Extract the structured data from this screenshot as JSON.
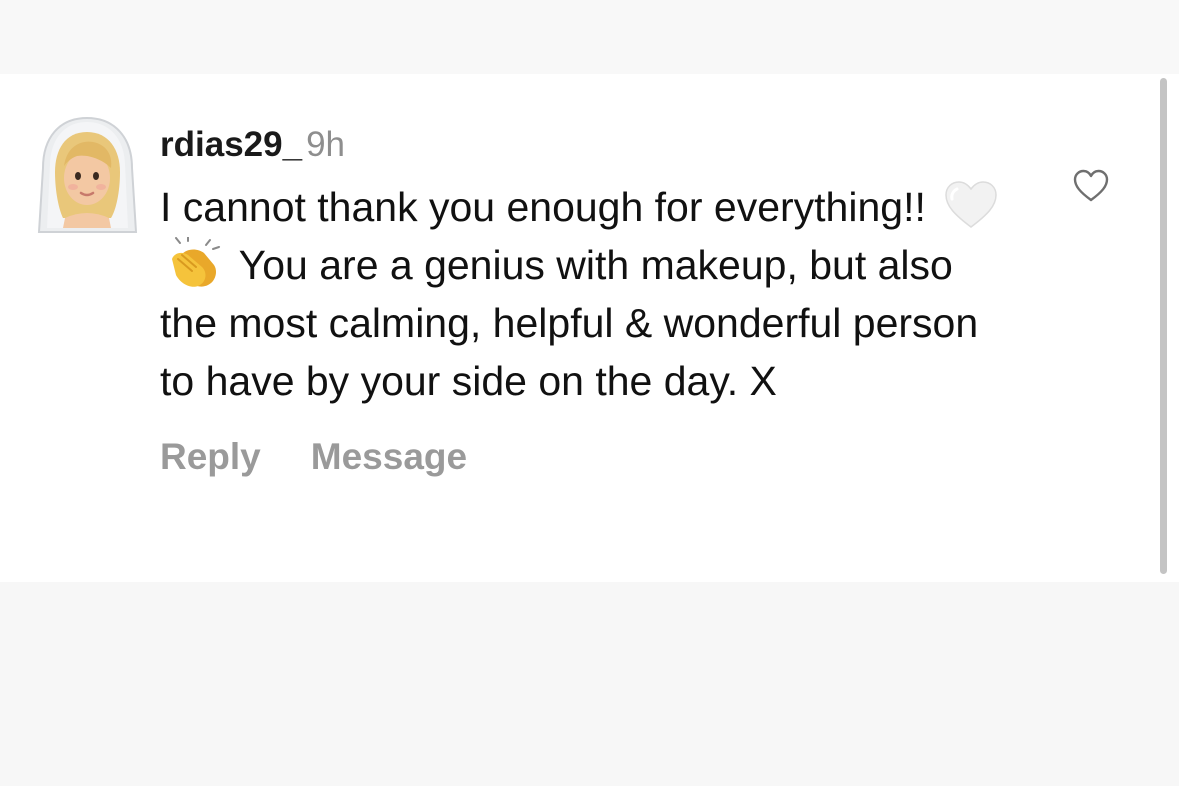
{
  "comment": {
    "username": "rdias29_",
    "timestamp": "9h",
    "text_part1": "I cannot thank you enough for everything!!",
    "emoji_1": "white-heart-icon",
    "emoji_2": "clapping-hands-icon",
    "text_part2": "You are a genius with makeup, but also the most calming, helpful & wonderful person to have by your side on the day. X",
    "avatar": "bride-with-veil-avatar",
    "actions": {
      "reply_label": "Reply",
      "message_label": "Message"
    }
  },
  "icons": {
    "like": "heart-outline-icon"
  },
  "colors": {
    "card_background": "#ffffff",
    "page_background": "#f8f8f8",
    "username": "#1a1a1a",
    "timestamp": "#8e8e8e",
    "action_text": "#9a9a9a",
    "scrollbar": "#c4c4c4"
  }
}
